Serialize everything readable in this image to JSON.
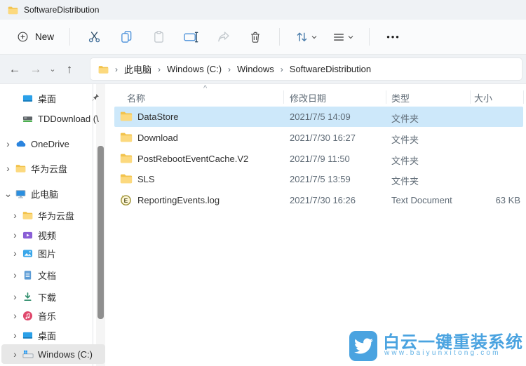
{
  "window": {
    "tab_title": "SoftwareDistribution"
  },
  "toolbar": {
    "new_label": "New",
    "buttons": [
      "new",
      "cut",
      "copy",
      "paste",
      "rename",
      "share",
      "delete",
      "sort",
      "view",
      "more"
    ]
  },
  "addressbar": {
    "crumbs": [
      "此电脑",
      "Windows (C:)",
      "Windows",
      "SoftwareDistribution"
    ]
  },
  "sidebar": {
    "items": [
      {
        "label": "桌面",
        "icon": "desktop-icon",
        "pinned": true
      },
      {
        "label": "TDDownload (\\",
        "icon": "network-drive-icon"
      },
      {
        "label": "OneDrive",
        "icon": "onedrive-icon",
        "expandable": true
      },
      {
        "label": "华为云盘",
        "icon": "folder-icon",
        "expandable": true
      },
      {
        "label": "此电脑",
        "icon": "this-pc-icon",
        "expanded": true
      },
      {
        "label": "华为云盘",
        "icon": "folder-icon",
        "expandable": true,
        "child": true
      },
      {
        "label": "视频",
        "icon": "videos-icon",
        "expandable": true,
        "child": true
      },
      {
        "label": "图片",
        "icon": "pictures-icon",
        "expandable": true,
        "child": true
      },
      {
        "label": "文档",
        "icon": "documents-icon",
        "expandable": true,
        "child": true
      },
      {
        "label": "下载",
        "icon": "downloads-icon",
        "expandable": true,
        "child": true
      },
      {
        "label": "音乐",
        "icon": "music-icon",
        "expandable": true,
        "child": true
      },
      {
        "label": "桌面",
        "icon": "desktop-icon",
        "expandable": true,
        "child": true
      },
      {
        "label": "Windows (C:)",
        "icon": "windows-drive-icon",
        "expandable": true,
        "child": true,
        "selected": true
      }
    ]
  },
  "list": {
    "headers": [
      "名称",
      "修改日期",
      "类型",
      "大小"
    ],
    "sorted_by": "名称",
    "rows": [
      {
        "name": "DataStore",
        "icon": "folder-icon",
        "date": "2021/7/5 14:09",
        "type": "文件夹",
        "size": "",
        "selected": true
      },
      {
        "name": "Download",
        "icon": "folder-icon",
        "date": "2021/7/30 16:27",
        "type": "文件夹",
        "size": ""
      },
      {
        "name": "PostRebootEventCache.V2",
        "icon": "folder-icon",
        "date": "2021/7/9 11:50",
        "type": "文件夹",
        "size": ""
      },
      {
        "name": "SLS",
        "icon": "folder-icon",
        "date": "2021/7/5 13:59",
        "type": "文件夹",
        "size": ""
      },
      {
        "name": "ReportingEvents.log",
        "icon": "event-log-icon",
        "date": "2021/7/30 16:26",
        "type": "Text Document",
        "size": "63 KB"
      }
    ]
  },
  "watermark": {
    "title": "白云一键重装系统",
    "url": "www.baiyunxitong.com",
    "logo": "twitter-bird-icon"
  },
  "icons": {
    "back": "←",
    "forward": "→",
    "history_chevron": "⌄",
    "up": "↑",
    "breadcrumb_sep": "›",
    "chevron_right": "›",
    "chevron_down": "⌄",
    "sort_asc": "^",
    "more": "•••",
    "new": "plus-circle",
    "cut": "scissors",
    "copy": "copy-pages",
    "paste": "clipboard",
    "rename": "rename-box",
    "share": "share-arrow",
    "delete": "trash-can",
    "sort": "sort-arrows",
    "view": "list-lines",
    "pin": "pushpin"
  },
  "colors": {
    "selection_blue": "#cde8fa",
    "sidebar_selected_gray": "#e7e7e7",
    "watermark_blue": "#4aa3e0",
    "folder_yellow": "#ffd76e",
    "chrome_gray": "#eff2f5"
  }
}
